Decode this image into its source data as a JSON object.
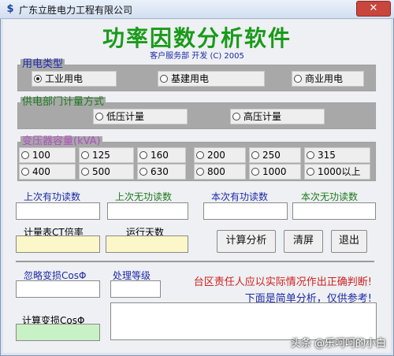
{
  "window": {
    "title": "广东立胜电力工程有限公司",
    "close_glyph": "✕",
    "icon_glyph": "$"
  },
  "header": {
    "title": "功率因数分析软件",
    "subtitle": "客户服务部 开发 (C) 2005"
  },
  "groups": {
    "electricity_type": {
      "label": "用电类型",
      "options": [
        "工业用电",
        "基建用电",
        "商业用电"
      ],
      "selected": 0
    },
    "metering": {
      "label": "供电部门计量方式",
      "options": [
        "低压计量",
        "高压计量"
      ],
      "selected": -1
    },
    "transformer": {
      "label": "变压器容量(kVA)",
      "options": [
        "100",
        "125",
        "160",
        "200",
        "250",
        "315",
        "400",
        "500",
        "630",
        "800",
        "1000",
        "1000以上"
      ],
      "selected": -1
    }
  },
  "fields": {
    "last_active": {
      "label": "上次有功读数",
      "value": ""
    },
    "last_reactive": {
      "label": "上次无功读数",
      "value": ""
    },
    "this_active": {
      "label": "本次有功读数",
      "value": ""
    },
    "this_reactive": {
      "label": "本次无功读数",
      "value": ""
    },
    "ct_ratio": {
      "label": "计量表CT倍率",
      "value": ""
    },
    "run_days": {
      "label": "运行天数",
      "value": ""
    },
    "ignore_loss": {
      "label": "忽略变损CosΦ",
      "value": ""
    },
    "grade": {
      "label": "处理等级",
      "value": ""
    },
    "calc_loss": {
      "label": "计算变损CosΦ",
      "value": ""
    }
  },
  "buttons": {
    "calculate": "计算分析",
    "clear": "清屏",
    "exit": "退出"
  },
  "notices": {
    "line1": "台区责任人应以实际情况作出正确判断!",
    "line2": "下面是简单分析，仅供参考!"
  },
  "watermark": "头条 @乐呵呵的小白",
  "colors": {
    "title_green": "#1a9a1a",
    "label_blue": "#1d2aa8",
    "notice_red": "#d02020"
  }
}
